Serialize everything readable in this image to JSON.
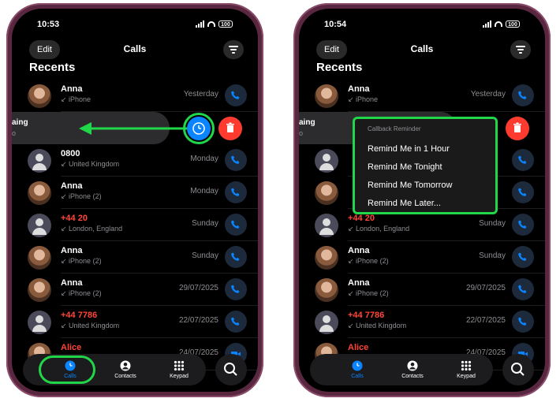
{
  "colors": {
    "accent": "#0a84ff",
    "missed": "#ff453a",
    "highlight": "#22d64a",
    "delete": "#ff3b30"
  },
  "left": {
    "status": {
      "time": "10:53",
      "battery": "100"
    },
    "header": {
      "edit": "Edit",
      "title": "Calls"
    },
    "section": "Recents",
    "swiped_fragment": [
      "aing",
      "o"
    ],
    "rows": [
      {
        "name": "Anna",
        "sub": "↙ iPhone",
        "date": "Yesterday",
        "missed": false,
        "avatar": "photo"
      },
      {
        "name": "0800",
        "sub": "↙ United Kingdom",
        "date": "Monday",
        "missed": false,
        "avatar": "generic"
      },
      {
        "name": "Anna",
        "sub": "↙ iPhone (2)",
        "date": "Monday",
        "missed": false,
        "avatar": "photo"
      },
      {
        "name": "+44 20",
        "sub": "↙ London, England",
        "date": "Sunday",
        "missed": true,
        "avatar": "generic"
      },
      {
        "name": "Anna",
        "sub": "↙ iPhone (2)",
        "date": "Sunday",
        "missed": false,
        "avatar": "photo"
      },
      {
        "name": "Anna",
        "sub": "↙ iPhone (2)",
        "date": "29/07/2025",
        "missed": false,
        "avatar": "photo"
      },
      {
        "name": "+44 7786",
        "sub": "↙ United Kingdom",
        "date": "22/07/2025",
        "missed": true,
        "avatar": "generic"
      },
      {
        "name": "Alice",
        "sub": "",
        "date": "24/07/2025",
        "missed": true,
        "avatar": "photo"
      }
    ],
    "tabs": {
      "calls": "Calls",
      "contacts": "Contacts",
      "keypad": "Keypad"
    }
  },
  "right": {
    "status": {
      "time": "10:54",
      "battery": "100"
    },
    "header": {
      "edit": "Edit",
      "title": "Calls"
    },
    "section": "Recents",
    "swiped_fragment": [
      "aing",
      "o"
    ],
    "rows": [
      {
        "name": "Anna",
        "sub": "↙ iPhone",
        "date": "Yesterday",
        "missed": false,
        "avatar": "photo"
      },
      {
        "name": "",
        "sub": "",
        "date": "",
        "missed": false,
        "avatar": "generic"
      },
      {
        "name": "",
        "sub": "",
        "date": "",
        "missed": false,
        "avatar": "photo"
      },
      {
        "name": "+44 20",
        "sub": "↙ London, England",
        "date": "Sunday",
        "missed": true,
        "avatar": "generic"
      },
      {
        "name": "Anna",
        "sub": "↙ iPhone (2)",
        "date": "Sunday",
        "missed": false,
        "avatar": "photo"
      },
      {
        "name": "Anna",
        "sub": "↙ iPhone (2)",
        "date": "29/07/2025",
        "missed": false,
        "avatar": "photo"
      },
      {
        "name": "+44 7786",
        "sub": "↙ United Kingdom",
        "date": "22/07/2025",
        "missed": true,
        "avatar": "generic"
      },
      {
        "name": "Alice",
        "sub": "",
        "date": "24/07/2025",
        "missed": true,
        "avatar": "photo"
      }
    ],
    "menu": {
      "header": "Callback Reminder",
      "items": [
        "Remind Me in 1 Hour",
        "Remind Me Tonight",
        "Remind Me Tomorrow",
        "Remind Me Later..."
      ]
    },
    "tabs": {
      "calls": "Calls",
      "contacts": "Contacts",
      "keypad": "Keypad"
    }
  }
}
